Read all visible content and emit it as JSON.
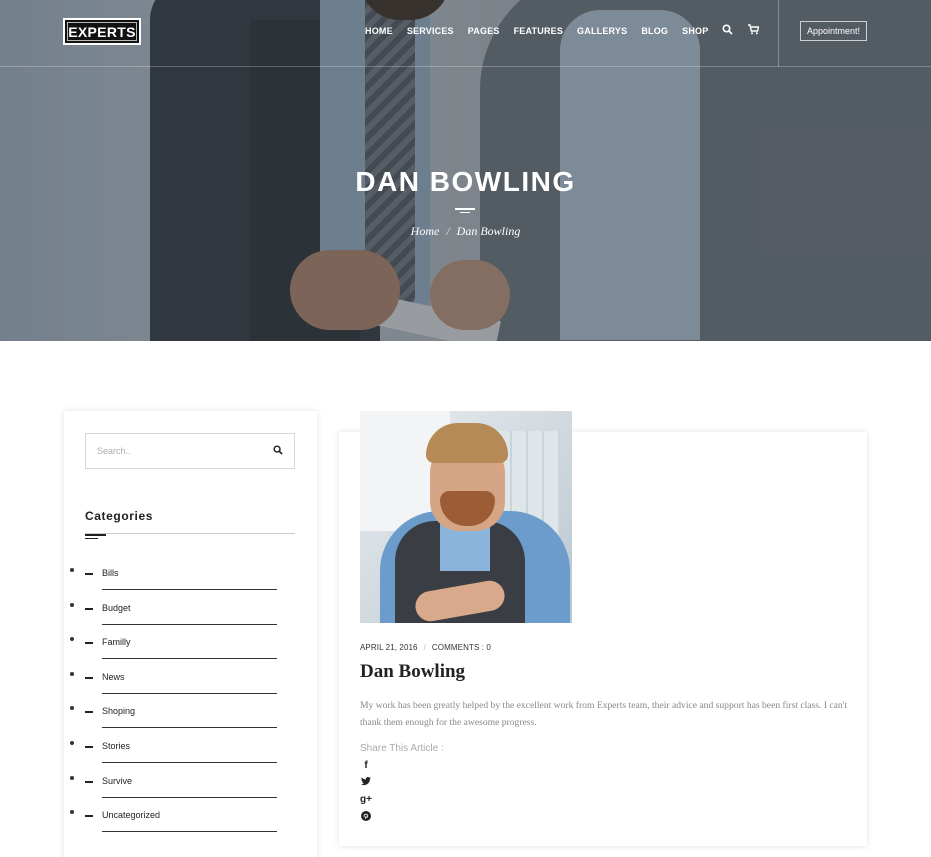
{
  "header": {
    "logo": "EXPERTS",
    "nav": [
      "HOME",
      "SERVICES",
      "PAGES",
      "FEATURES",
      "GALLERYS",
      "BLOG",
      "SHOP"
    ],
    "search_icon": "search-icon",
    "cart_icon": "cart-icon",
    "appointment_label": "Appointment!"
  },
  "hero": {
    "title": "DAN BOWLING",
    "breadcrumb": {
      "home": "Home",
      "separator": "/",
      "current": "Dan Bowling"
    }
  },
  "sidebar": {
    "search_placeholder": "Search..",
    "categories_title": "Categories",
    "categories": [
      "Bills",
      "Budget",
      "Familly",
      "News",
      "Shoping",
      "Stories",
      "Survive",
      "Uncategorized"
    ]
  },
  "post": {
    "date": "APRIL 21, 2016",
    "meta_separator": "/",
    "comments": "COMMENTS : 0",
    "title": "Dan Bowling",
    "excerpt": "My work has been greatly helped by the excellent work from Experts team, their advice and support has been first class. I can't thank them enough for the awesome progress.",
    "share_label": "Share This Article :",
    "social": [
      {
        "icon": "facebook-icon",
        "glyph": "f"
      },
      {
        "icon": "twitter-icon",
        "glyph": "✈"
      },
      {
        "icon": "google-plus-icon",
        "glyph": "g+"
      },
      {
        "icon": "pinterest-icon",
        "glyph": "Ⓟ"
      }
    ]
  }
}
